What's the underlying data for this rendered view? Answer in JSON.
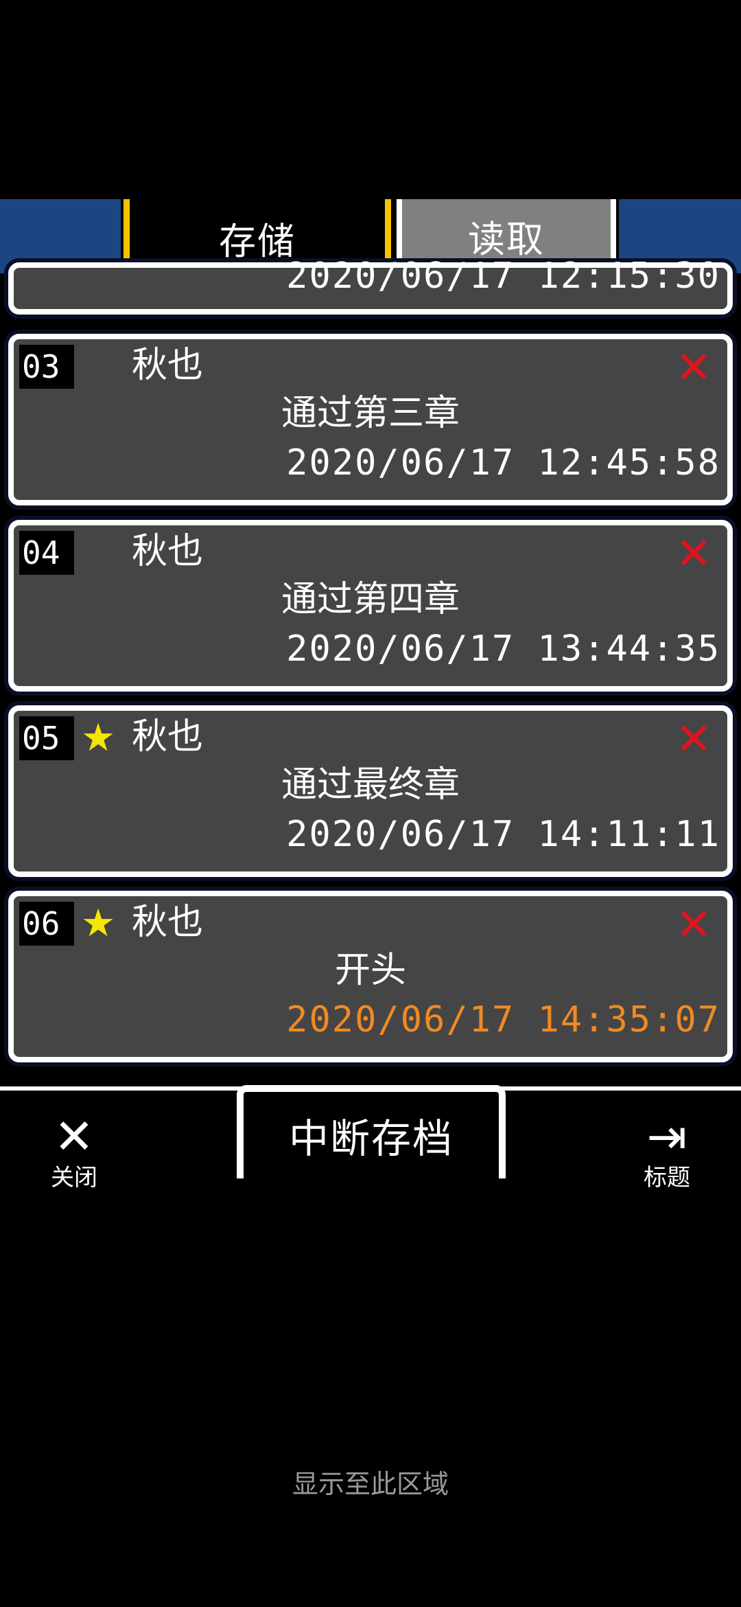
{
  "tabs": {
    "save": "存储",
    "load": "读取"
  },
  "partial_slot": {
    "timestamp": "2020/06/17 12:15:30"
  },
  "slots": [
    {
      "number": "03",
      "starred": false,
      "name": "秋也",
      "chapter": "通过第三章",
      "timestamp": "2020/06/17 12:45:58",
      "current": false
    },
    {
      "number": "04",
      "starred": false,
      "name": "秋也",
      "chapter": "通过第四章",
      "timestamp": "2020/06/17 13:44:35",
      "current": false
    },
    {
      "number": "05",
      "starred": true,
      "name": "秋也",
      "chapter": "通过最终章",
      "timestamp": "2020/06/17 14:11:11",
      "current": false
    },
    {
      "number": "06",
      "starred": true,
      "name": "秋也",
      "chapter": "开头",
      "timestamp": "2020/06/17 14:35:07",
      "current": true
    }
  ],
  "icons": {
    "star": "★",
    "delete": "✕",
    "close": "✕",
    "exit": "⇥"
  },
  "controls": {
    "suspend": "中断存档",
    "close": "关闭",
    "title": "标题"
  },
  "footer_note": "显示至此区域",
  "colors": {
    "tab_active": "#f5c400",
    "bar_blue": "#1c4681",
    "delete": "#e0141e",
    "star": "#f5e600",
    "current_time": "#f08a24"
  }
}
